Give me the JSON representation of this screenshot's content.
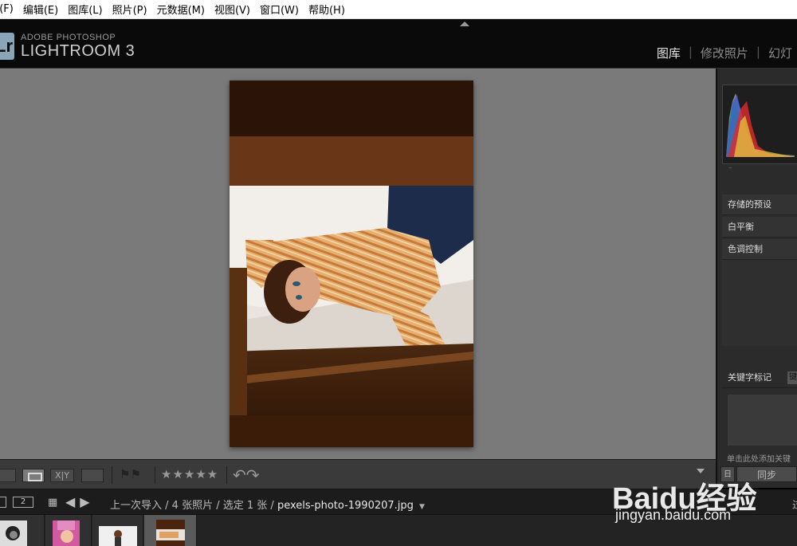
{
  "menu": [
    "‹(F)",
    "编辑(E)",
    "图库(L)",
    "照片(P)",
    "元数据(M)",
    "视图(V)",
    "窗口(W)",
    "帮助(H)"
  ],
  "app": {
    "badge": "Lr",
    "brand_small": "ADOBE PHOTOSHOP",
    "brand_large": "LIGHTROOM 3"
  },
  "modules": [
    "图库",
    "修改照片",
    "幻灯"
  ],
  "active_module": "图库",
  "right_panel": {
    "histogram_caption": "–",
    "sections": [
      "存储的预设",
      "白平衡",
      "色调控制"
    ],
    "keywords_label": "关键字标记",
    "keywords_button": "键",
    "keyword_hint": "单击此处添加关键",
    "sync_left": "日",
    "sync_button": "同步"
  },
  "toolbar": {
    "compare_label": "X|Y",
    "flags": "⚑⚑",
    "stars": "★★★★★",
    "rotate": "↶↷"
  },
  "filmbar": {
    "secondary_label": "2",
    "source": "上一次导入",
    "count": "4 张照片",
    "selected": "选定 1 张",
    "filename": "pexels-photo-1990207.jpg",
    "right_label": "过"
  },
  "thumbnails": [
    {
      "name": "thumb-1",
      "selected": false
    },
    {
      "name": "thumb-2",
      "selected": false
    },
    {
      "name": "thumb-3",
      "selected": false
    },
    {
      "name": "thumb-4",
      "selected": true
    }
  ],
  "watermark": {
    "logo": "Baidu经验",
    "url": "jingyan.baidu.com"
  },
  "colors": {
    "center_bg": "#7a7a7a",
    "panel_bg": "#2b2b2b",
    "header_bg": "#0a0a0a",
    "active_module": "#e8e8e8",
    "inactive_module": "#8c8c8c"
  }
}
